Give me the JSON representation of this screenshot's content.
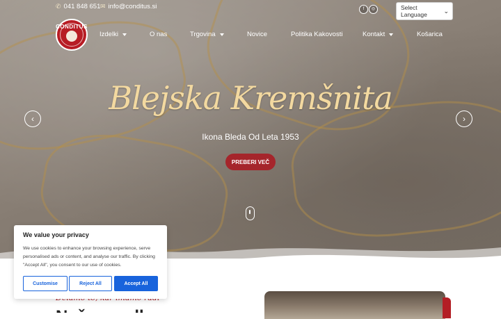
{
  "topbar": {
    "phone": "041 848 651",
    "email": "info@conditus.si",
    "language_select": "Select Language"
  },
  "logo": {
    "brand": "CONDITUS"
  },
  "nav": {
    "items": [
      {
        "label": "Izdelki",
        "dropdown": true
      },
      {
        "label": "O nas",
        "dropdown": false
      },
      {
        "label": "Trgovina",
        "dropdown": true
      },
      {
        "label": "Novice",
        "dropdown": false
      },
      {
        "label": "Politika Kakovosti",
        "dropdown": false
      },
      {
        "label": "Kontakt",
        "dropdown": true
      },
      {
        "label": "Košarica",
        "dropdown": false
      }
    ]
  },
  "hero": {
    "title": "Blejska Kremšnita",
    "subtitle": "Ikona Bleda Od Leta 1953",
    "cta": "PREBERI VEČ",
    "prev_icon": "chevron-left-icon",
    "next_icon": "chevron-right-icon"
  },
  "below": {
    "tagline": "Delamo to, kar imamo radi",
    "heading": "Naša zgodba"
  },
  "cookie": {
    "title": "We value your privacy",
    "text": "We use cookies to enhance your browsing experience, serve personalised ads or content, and analyse our traffic. By clicking \"Accept All\", you consent to our use of cookies.",
    "customise": "Customise",
    "reject": "Reject All",
    "accept": "Accept All"
  },
  "colors": {
    "brand_red": "#a5252b",
    "title_gold": "#f3d9a0",
    "cookie_blue": "#1863dc"
  }
}
